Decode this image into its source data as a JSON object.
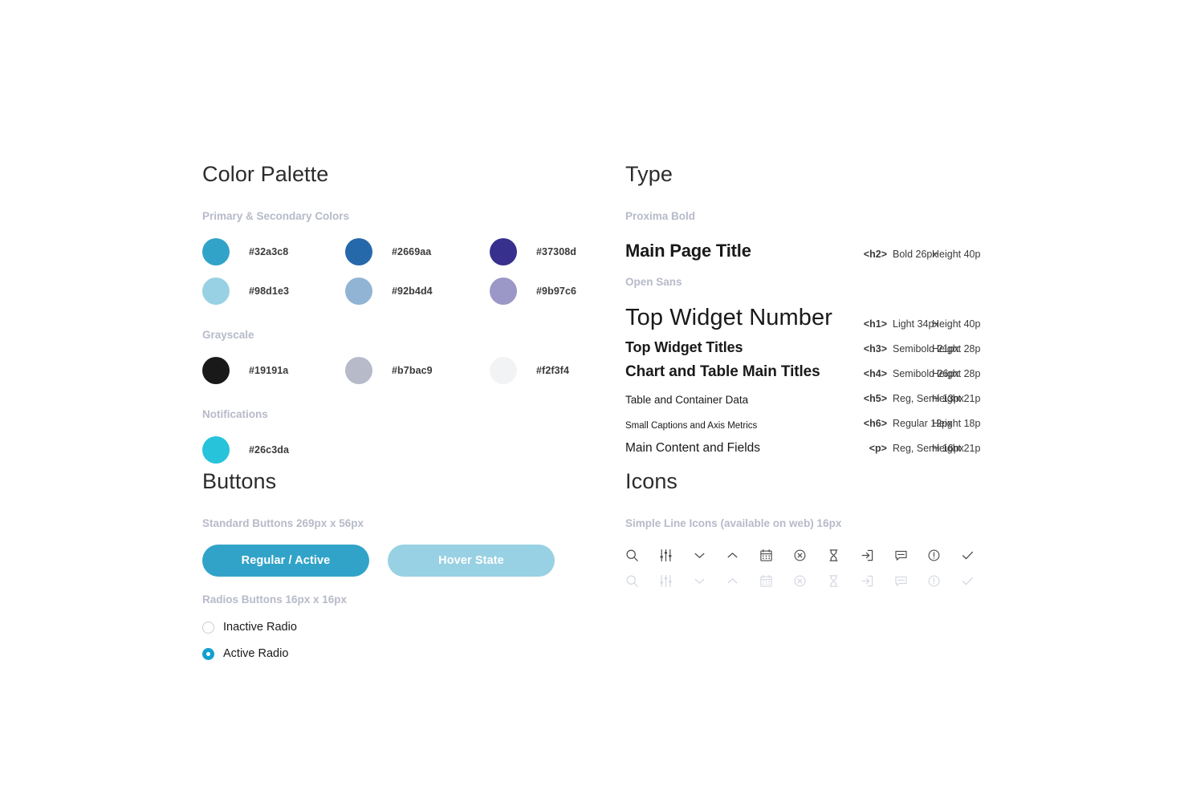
{
  "page": {
    "background": "#ffffff"
  },
  "color_palette": {
    "title": "Color Palette",
    "groups": [
      {
        "label": "Primary & Secondary Colors",
        "rows": [
          [
            {
              "hex": "#32a3c8",
              "name": "primary-teal"
            },
            {
              "hex": "#2669aa",
              "name": "primary-blue"
            },
            {
              "hex": "#37308d",
              "name": "primary-indigo"
            }
          ],
          [
            {
              "hex": "#98d1e3",
              "name": "secondary-light-teal"
            },
            {
              "hex": "#92b4d4",
              "name": "secondary-light-blue"
            },
            {
              "hex": "#9b97c6",
              "name": "secondary-light-purple"
            }
          ]
        ]
      },
      {
        "label": "Grayscale",
        "rows": [
          [
            {
              "hex": "#19191a",
              "name": "gray-black"
            },
            {
              "hex": "#b7bac9",
              "name": "gray-mid"
            },
            {
              "hex": "#f2f3f4",
              "name": "gray-light"
            }
          ]
        ]
      },
      {
        "label": "Notifications",
        "rows": [
          [
            {
              "hex": "#26c3da",
              "name": "notification-cyan"
            }
          ]
        ]
      }
    ]
  },
  "type": {
    "title": "Type",
    "families": [
      {
        "label": "Proxima Bold",
        "rows": [
          {
            "sample": "Main Page Title",
            "tag": "<h2>",
            "spec": "Bold 26px",
            "height": "Height 40p",
            "style": "s-h2"
          }
        ]
      },
      {
        "label": "Open Sans",
        "rows": [
          {
            "sample": "Top Widget Number",
            "tag": "<h1>",
            "spec": "Light 34px",
            "height": "Height 40p",
            "style": "s-h1"
          },
          {
            "sample": "Top Widget Titles",
            "tag": "<h3>",
            "spec": "Semibold 21px",
            "height": "Height 28p",
            "style": "s-h3"
          },
          {
            "sample": "Chart and Table Main Titles",
            "tag": "<h4>",
            "spec": "Semibold 26px",
            "height": "Height 28p",
            "style": "s-h4"
          },
          {
            "sample": "Table and Container Data",
            "tag": "<h5>",
            "spec": "Reg, Semi 13px",
            "height": "Height 21p",
            "style": "s-h5"
          },
          {
            "sample": "Small Captions and Axis Metrics",
            "tag": "<h6>",
            "spec": "Regular 12px",
            "height": "Height 18p",
            "style": "s-h6"
          },
          {
            "sample": "Main Content and Fields",
            "tag": "<p>",
            "spec": "Reg, Semi 16px",
            "height": "Height 21p",
            "style": "s-p"
          }
        ]
      }
    ]
  },
  "buttons": {
    "title": "Buttons",
    "standard_label": "Standard Buttons 269px x 56px",
    "regular": {
      "label": "Regular / Active",
      "color": "#32a3c8"
    },
    "hover": {
      "label": "Hover State",
      "color": "#98d1e3"
    },
    "radio_label": "Radios Buttons 16px x 16px",
    "radios": [
      {
        "label": "Inactive Radio",
        "active": false
      },
      {
        "label": "Active Radio",
        "active": true
      }
    ]
  },
  "icons": {
    "title": "Icons",
    "label": "Simple Line Icons (available on web) 16px",
    "active_color": "#4a4a4e",
    "disabled_color": "#d4d7e2",
    "items": [
      "search-icon",
      "sliders-icon",
      "chevron-down-icon",
      "chevron-up-icon",
      "calendar-icon",
      "circle-x-icon",
      "hourglass-icon",
      "sign-in-icon",
      "comment-icon",
      "info-circle-icon",
      "check-icon"
    ]
  }
}
